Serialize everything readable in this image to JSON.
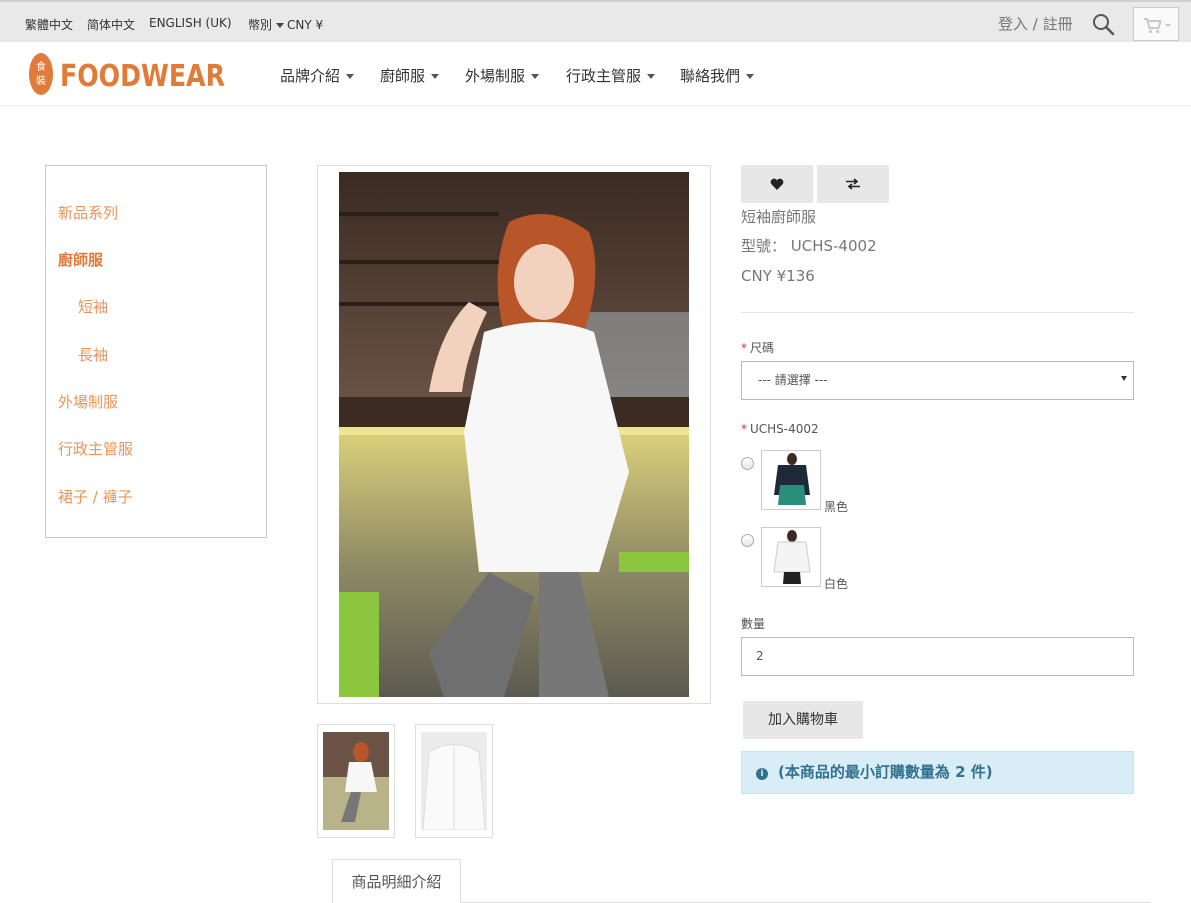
{
  "topbar": {
    "languages": [
      "繁體中文",
      "简体中文",
      "ENGLISH (UK)"
    ],
    "currency_label": "幣別",
    "currency_value": "CNY ¥",
    "login": "登入 / 註冊"
  },
  "icons": {
    "search": "search-icon",
    "cart": "shopping-cart-icon",
    "wishlist": "heart-icon",
    "compare": "exchange-icon",
    "info": "info-icon"
  },
  "header": {
    "brand": "FOODWEAR",
    "brand_seal": "食裝",
    "nav": [
      "品牌介紹",
      "廚師服",
      "外場制服",
      "行政主管服",
      "聯絡我們"
    ]
  },
  "sidebar": {
    "items": [
      {
        "label": "新品系列",
        "active": false,
        "sub": false
      },
      {
        "label": "廚師服",
        "active": true,
        "sub": false
      },
      {
        "label": "短袖",
        "active": false,
        "sub": true
      },
      {
        "label": "長袖",
        "active": false,
        "sub": true
      },
      {
        "label": "外場制服",
        "active": false,
        "sub": false
      },
      {
        "label": "行政主管服",
        "active": false,
        "sub": false
      },
      {
        "label": "裙子 / 褲子",
        "active": false,
        "sub": false
      }
    ]
  },
  "product": {
    "name": "短袖廚師服",
    "model": "型號： UCHS-4002",
    "price": "CNY ¥136",
    "size_label": "尺碼",
    "size_placeholder": "--- 請選擇 ---",
    "option_label": "UCHS-4002",
    "options": [
      {
        "label": "黑色"
      },
      {
        "label": "白色"
      }
    ],
    "qty_label": "數量",
    "qty_value": "2",
    "add_to_cart": "加入購物車",
    "min_notice": "(本商品的最小訂購數量為 2 件)"
  },
  "tabs": {
    "details": "商品明細介紹"
  },
  "colors": {
    "brand_orange": "#e07b3a",
    "sidebar_link": "#e8955a",
    "alert_bg": "#d9edf7",
    "alert_text": "#31708f",
    "required_star": "#d9302c"
  }
}
